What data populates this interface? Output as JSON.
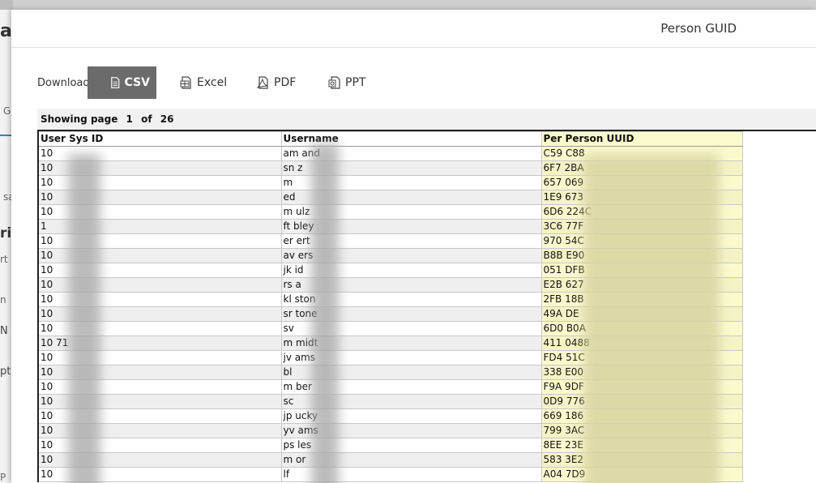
{
  "background": {
    "fragments": [
      "at",
      "G",
      "sa",
      "rib",
      "rt",
      "n",
      "N",
      "pti",
      "P"
    ]
  },
  "dialog": {
    "title": "Person GUID"
  },
  "download": {
    "label": "Download",
    "buttons": [
      {
        "label": "CSV",
        "icon": "csv-file-icon",
        "active": true
      },
      {
        "label": "Excel",
        "icon": "excel-file-icon",
        "active": false
      },
      {
        "label": "PDF",
        "icon": "pdf-file-icon",
        "active": false
      },
      {
        "label": "PPT",
        "icon": "ppt-file-icon",
        "active": false
      }
    ]
  },
  "report": {
    "showing_page_label": "Showing page",
    "current_page": "1",
    "of_label": "of",
    "total_pages": "26",
    "columns": [
      "User Sys ID",
      "Username",
      "Per Person UUID"
    ],
    "rows": [
      [
        "10",
        "am  and",
        "C59  C88"
      ],
      [
        "10",
        "sn  z",
        "6F7  2BA"
      ],
      [
        "10",
        "m",
        "657  069"
      ],
      [
        "10",
        "ed",
        "1E9  673"
      ],
      [
        "10",
        "m  ulz",
        "6D6  224C"
      ],
      [
        "1",
        "ft  bley",
        "3C6  77F"
      ],
      [
        "10",
        "er  ert",
        "970  54C"
      ],
      [
        "10",
        "av  ers",
        "B8B  E90"
      ],
      [
        "10",
        "jk  id",
        "051  DFB"
      ],
      [
        "10",
        "rs  a",
        "E2B  627"
      ],
      [
        "10",
        "kl  ston",
        "2FB  18B"
      ],
      [
        "10",
        "sr  tone",
        "49A  DE"
      ],
      [
        "10",
        "sv",
        "6D0  B0A"
      ],
      [
        "10  71",
        "m  midt",
        "411  0488"
      ],
      [
        "10",
        "jv  ams",
        "FD4  51C"
      ],
      [
        "10",
        "bl",
        "338  E00"
      ],
      [
        "10",
        "m  ber",
        "F9A  9DF"
      ],
      [
        "10",
        "sc",
        "0D9  776"
      ],
      [
        "10",
        "jp  ucky",
        "669  186"
      ],
      [
        "10",
        "yv  ams",
        "799  3AC"
      ],
      [
        "10",
        "ps  les",
        "8EE  23E"
      ],
      [
        "10",
        "m  or",
        "583  3E2"
      ],
      [
        "10",
        "lf",
        "A04  7D9"
      ]
    ]
  }
}
